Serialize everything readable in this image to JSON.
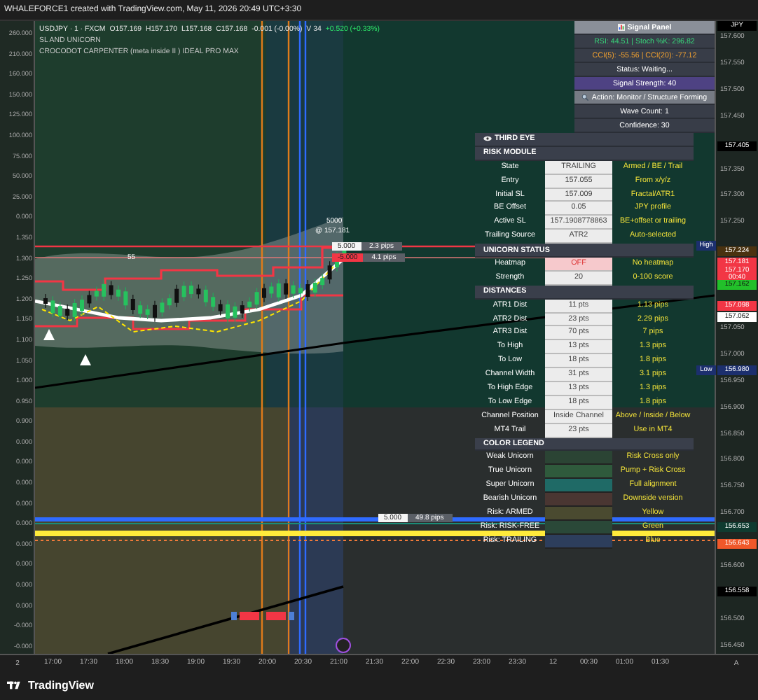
{
  "attribution": "WHALEFORCE1 created with TradingView.com, May 11, 2026 20:49 UTC+3:30",
  "legend": {
    "symbol": "USDJPY · 1 · FXCM",
    "ohlc": [
      "O157.169",
      "H157.170",
      "L157.168",
      "C157.168"
    ],
    "change": "-0.001 (-0.00%)",
    "volume": "V 34",
    "session_change": "+0.520 (+0.33%)",
    "indicators": [
      "SL AND UNICORN",
      "CROCODOT CARPENTER (meta inside II ) IDEAL PRO MAX"
    ]
  },
  "left_axis": {
    "labels": [
      "260.000",
      "210.000",
      "160.000",
      "150.000",
      "125.000",
      "100.000",
      "75.000",
      "50.000",
      "25.000",
      "0.000",
      "1.350",
      "1.300",
      "1.250",
      "1.200",
      "1.150",
      "1.100",
      "1.050",
      "1.000",
      "0.950",
      "0.900",
      "0.000",
      "0.000",
      "0.000",
      "0.000",
      "0.000",
      "0.000",
      "0.000",
      "0.000",
      "0.000",
      "-0.000",
      "-0.000"
    ]
  },
  "price_axis": {
    "labels": [
      "157.600",
      "157.550",
      "157.500",
      "157.450",
      "157.350",
      "157.300",
      "157.250",
      "157.050",
      "157.000",
      "156.950",
      "156.900",
      "156.850",
      "156.800",
      "156.750",
      "156.700",
      "156.600",
      "156.500",
      "156.450"
    ],
    "tags": [
      {
        "text": "JPY",
        "color": "#000000",
        "kind": "light-text"
      },
      {
        "text": "157.405",
        "color": "#000000",
        "kind": "light-text"
      },
      {
        "text": "High",
        "color": "#1c2f6e",
        "kind": "side"
      },
      {
        "text": "157.224",
        "color": "#4a3210",
        "kind": "light-text"
      },
      {
        "text": "157.181",
        "color": "#f23645",
        "kind": "light-text"
      },
      {
        "text": "157.170",
        "color": "#f23645",
        "kind": "light-text"
      },
      {
        "text": "00:40",
        "color": "#f23645",
        "kind": "light-text"
      },
      {
        "text": "157.162",
        "color": "#22c02a",
        "kind": "dark-text"
      },
      {
        "text": "157.098",
        "color": "#f23645",
        "kind": "light-text"
      },
      {
        "text": "157.062",
        "color": "#ffffff",
        "kind": "dark-text"
      },
      {
        "text": "Low",
        "color": "#1c2f6e",
        "kind": "side"
      },
      {
        "text": "156.980",
        "color": "#1c2f6e",
        "kind": "light-text"
      },
      {
        "text": "156.653",
        "color": "#0f3b30",
        "kind": "light-text"
      },
      {
        "text": "156.643",
        "color": "#f0582a",
        "kind": "light-text"
      },
      {
        "text": "156.558",
        "color": "#000000",
        "kind": "light-text"
      }
    ]
  },
  "chart_labels": [
    {
      "text": "55"
    },
    {
      "text": "5000"
    },
    {
      "text": "@ 157.181"
    }
  ],
  "position_labels": [
    {
      "qty": "5.000",
      "pips": "2.3 pips",
      "color": "#f5f5f5"
    },
    {
      "qty": "-5.000",
      "pips": "4.1 pips",
      "color": "#f23645"
    },
    {
      "qty": "5.000",
      "pips": "49.8 pips",
      "color": "#f5f5f5"
    }
  ],
  "signal_panel": [
    {
      "text": "Signal Panel",
      "kind": "title"
    },
    {
      "text": "RSI: 44.51 | Stoch %K: 296.82",
      "kind": "rsi"
    },
    {
      "text": "CCI(5): -55.56 | CCI(20): -77.12",
      "kind": "cci"
    },
    {
      "text": "Status: Waiting...",
      "kind": "plain"
    },
    {
      "text": "Signal Strength: 40",
      "kind": "strength"
    },
    {
      "text": "Action: Monitor / Structure Forming",
      "kind": "action"
    },
    {
      "text": "Wave Count: 1",
      "kind": "plain"
    },
    {
      "text": "Confidence: 30",
      "kind": "plain"
    }
  ],
  "table": [
    {
      "kind": "eye-section",
      "label": "THIRD EYE"
    },
    {
      "kind": "section",
      "label": "RISK MODULE"
    },
    {
      "kind": "row",
      "label": "State",
      "value": "TRAILING",
      "note": "Armed / BE / Trail"
    },
    {
      "kind": "row",
      "label": "Entry",
      "value": "157.055",
      "note": "From x/y/z"
    },
    {
      "kind": "row",
      "label": "Initial SL",
      "value": "157.009",
      "note": "Fractal/ATR1"
    },
    {
      "kind": "row",
      "label": "BE Offset",
      "value": "0.05",
      "note": "JPY profile"
    },
    {
      "kind": "row",
      "label": "Active SL",
      "value": "157.1908778863",
      "note": "BE+offset or trailing"
    },
    {
      "kind": "row",
      "label": "Trailing Source",
      "value": "ATR2",
      "note": "Auto-selected"
    },
    {
      "kind": "section",
      "label": "UNICORN STATUS"
    },
    {
      "kind": "alert",
      "label": "Heatmap",
      "value": "OFF",
      "note": "No heatmap"
    },
    {
      "kind": "row",
      "label": "Strength",
      "value": "20",
      "note": "0-100 score"
    },
    {
      "kind": "section",
      "label": "DISTANCES"
    },
    {
      "kind": "row",
      "label": "ATR1 Dist",
      "value": "11 pts",
      "note": "1.13 pips"
    },
    {
      "kind": "row",
      "label": "ATR2 Dist",
      "value": "23 pts",
      "note": "2.29 pips"
    },
    {
      "kind": "row",
      "label": "ATR3 Dist",
      "value": "70 pts",
      "note": "7 pips"
    },
    {
      "kind": "row",
      "label": "To High",
      "value": "13 pts",
      "note": "1.3 pips"
    },
    {
      "kind": "row",
      "label": "To Low",
      "value": "18 pts",
      "note": "1.8 pips"
    },
    {
      "kind": "row",
      "label": "Channel Width",
      "value": "31 pts",
      "note": "3.1 pips"
    },
    {
      "kind": "row",
      "label": "To High Edge",
      "value": "13 pts",
      "note": "1.3 pips"
    },
    {
      "kind": "row",
      "label": "To Low Edge",
      "value": "18 pts",
      "note": "1.8 pips"
    },
    {
      "kind": "row",
      "label": "Channel Position",
      "value": "Inside Channel",
      "note": "Above / Inside / Below"
    },
    {
      "kind": "row",
      "label": "MT4 Trail",
      "value": "23 pts",
      "note": "Use in MT4"
    },
    {
      "kind": "section",
      "label": "COLOR LEGEND"
    },
    {
      "kind": "legend",
      "label": "Weak Unicorn",
      "color": "#2b4434",
      "note": "Risk Cross only"
    },
    {
      "kind": "legend",
      "label": "True Unicorn",
      "color": "#2f5a3c",
      "note": "Pump + Risk Cross"
    },
    {
      "kind": "legend",
      "label": "Super Unicorn",
      "color": "#1f6a66",
      "note": "Full alignment"
    },
    {
      "kind": "legend",
      "label": "Bearish Unicorn",
      "color": "#4a3632",
      "note": "Downside version"
    },
    {
      "kind": "legend",
      "label": "Risk: ARMED",
      "color": "#4a4a30",
      "note": "Yellow"
    },
    {
      "kind": "legend",
      "label": "Risk: RISK-FREE",
      "color": "#2a4838",
      "note": "Green"
    },
    {
      "kind": "legend",
      "label": "Risk: TRAILING",
      "color": "#2d3e5c",
      "note": "Blue"
    }
  ],
  "time_axis": {
    "left_button": "2",
    "labels": [
      "17:00",
      "17:30",
      "18:00",
      "18:30",
      "19:00",
      "19:30",
      "20:00",
      "20:30",
      "21:00",
      "21:30",
      "22:00",
      "22:30",
      "23:00",
      "23:30",
      "12",
      "00:30",
      "01:00",
      "01:30"
    ],
    "right_button": "A"
  },
  "footer": {
    "brand": "TradingView"
  }
}
